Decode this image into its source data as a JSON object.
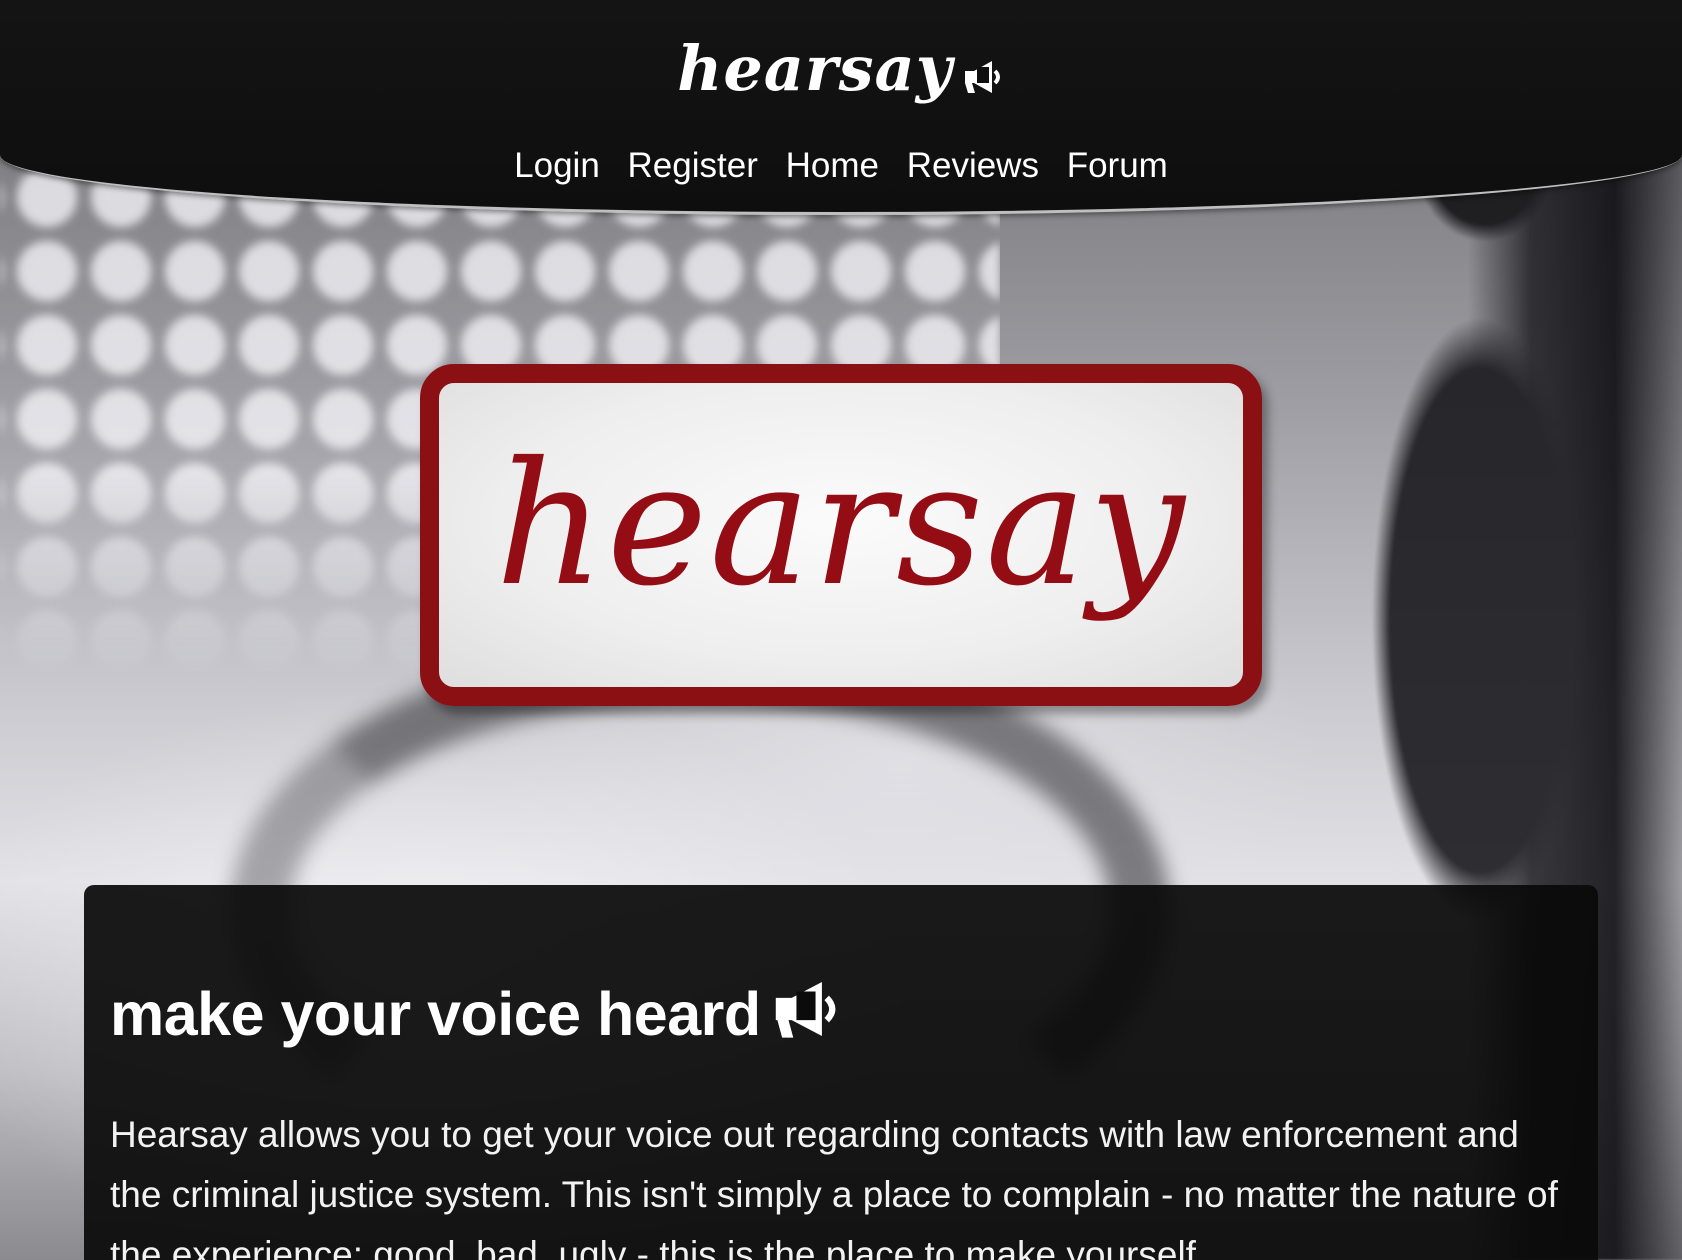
{
  "header": {
    "brand": "hearsay",
    "brand_icon": "megaphone-icon",
    "nav": [
      "Login",
      "Register",
      "Home",
      "Reviews",
      "Forum"
    ]
  },
  "hero": {
    "logo_text": "hearsay",
    "logo_color": "#950d14",
    "logo_border_color": "#8b1013"
  },
  "intro": {
    "heading": "make your voice heard",
    "heading_icon": "megaphone-icon",
    "body": "Hearsay allows you to get your voice out regarding contacts with law enforcement and the criminal justice system. This isn't simply a place to complain - no matter the nature of the experience: good, bad, ugly - this is the place to make yourself"
  }
}
